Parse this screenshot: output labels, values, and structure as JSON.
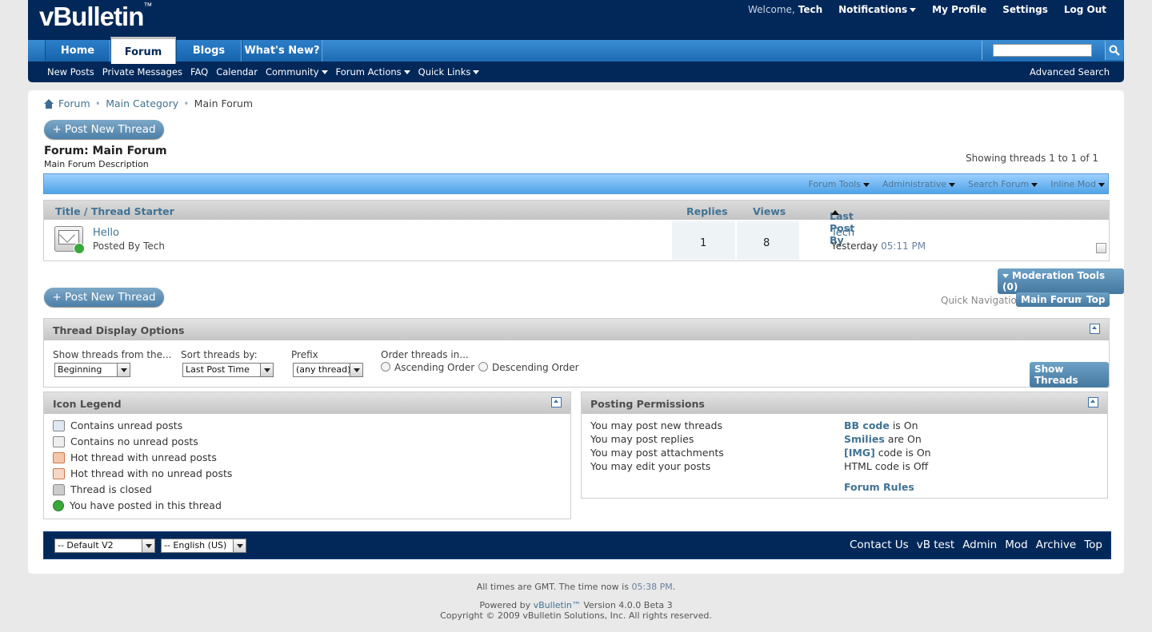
{
  "header": {
    "logo": "vBulletin",
    "logo_tm": "™",
    "welcome_label": "Welcome,",
    "username": "Tech",
    "links": [
      "Notifications",
      "My Profile",
      "Settings",
      "Log Out"
    ],
    "tabs": [
      "Home",
      "Forum",
      "Blogs",
      "What's New?"
    ],
    "active_tab": "Forum",
    "search_placeholder": "",
    "subnav": [
      "New Posts",
      "Private Messages",
      "FAQ",
      "Calendar",
      "Community",
      "Forum Actions",
      "Quick Links"
    ],
    "advanced_search": "Advanced Search",
    "bg_color": "#02285a"
  },
  "breadcrumb": [
    "Forum",
    "Main Category",
    "Main Forum"
  ],
  "forum": {
    "post_new_thread": "+ Post New Thread",
    "title": "Forum: Main Forum",
    "description": "Main Forum Description",
    "showing": "Showing threads 1 to 1 of 1",
    "tools": [
      "Forum Tools",
      "Administrative",
      "Search Forum",
      "Inline Mod"
    ]
  },
  "threadlist": {
    "headers": {
      "title": "Title / Thread Starter",
      "replies": "Replies",
      "views": "Views",
      "lastpost": "Last Post By"
    },
    "rows": [
      {
        "title": "Hello",
        "starter": "Posted By Tech",
        "replies": "1",
        "views": "8",
        "last_user": "Tech",
        "last_date": "Yesterday",
        "last_time": "05:11 PM"
      }
    ]
  },
  "moderation": {
    "tools_label": "Moderation Tools (0)",
    "quick_nav_label": "Quick Navigation",
    "main_forum_btn": "Main Forum",
    "top_btn": "Top"
  },
  "display_options": {
    "title": "Thread Display Options",
    "show_from_label": "Show threads from the...",
    "show_from_value": "Beginning",
    "sort_label": "Sort threads by:",
    "sort_value": "Last Post Time",
    "prefix_label": "Prefix",
    "prefix_value": "(any thread)",
    "order_label": "Order threads in...",
    "ascending": "Ascending Order",
    "descending": "Descending Order",
    "show_btn": "Show Threads"
  },
  "legend": {
    "title": "Icon Legend",
    "items": [
      "Contains unread posts",
      "Contains no unread posts",
      "Hot thread with unread posts",
      "Hot thread with no unread posts",
      "Thread is closed",
      "You have posted in this thread"
    ]
  },
  "permissions": {
    "title": "Posting Permissions",
    "left": [
      "You may post new threads",
      "You may post replies",
      "You may post attachments",
      "You may edit your posts"
    ],
    "right": [
      {
        "key": "BB code",
        "rest": " is On"
      },
      {
        "key": "Smilies",
        "rest": " are On"
      },
      {
        "key": "[IMG]",
        "rest": " code is On"
      },
      {
        "key": "",
        "rest": "HTML code is Off"
      }
    ],
    "rules": "Forum Rules"
  },
  "footer": {
    "style_select": "-- Default V2",
    "lang_select": "-- English (US)",
    "links": [
      "Contact Us",
      "vB test",
      "Admin",
      "Mod",
      "Archive",
      "Top"
    ],
    "times": "All times are GMT. The time now is",
    "time_now": "05:38 PM",
    "powered_by": "Powered by",
    "powered_link": "vBulletin™",
    "version": "Version 4.0.0 Beta 3",
    "copyright": "Copyright © 2009 vBulletin Solutions, Inc. All rights reserved."
  }
}
